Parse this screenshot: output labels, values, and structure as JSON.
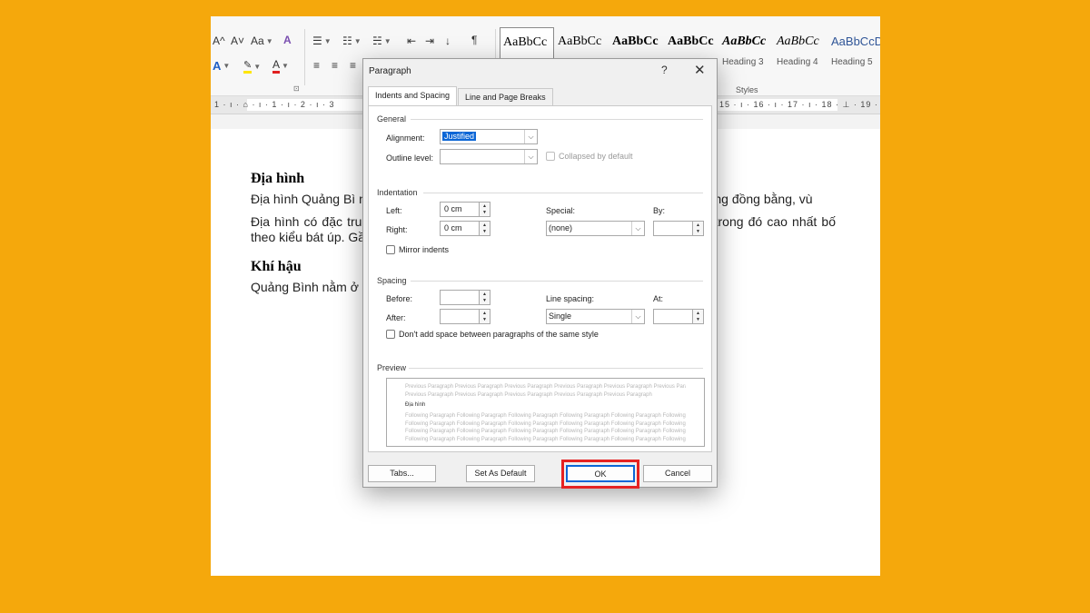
{
  "ribbon": {
    "grow_font": "A^",
    "shrink_font": "A˅",
    "change_case": "Aa",
    "clear_formatting": "A",
    "show_marks": "¶",
    "styles_label": "Styles",
    "paragraph_launcher": "⊡",
    "styles": [
      {
        "sample": "AaBbCc",
        "name": ""
      },
      {
        "sample": "AaBbCc",
        "name": ""
      },
      {
        "sample": "AaBbCc",
        "name": ""
      },
      {
        "sample": "AaBbCc",
        "name": ""
      },
      {
        "sample": "AaBbCc",
        "name": "Heading 3"
      },
      {
        "sample": "AaBbCc",
        "name": "Heading 4"
      },
      {
        "sample": "AaBbCcD",
        "name": "Heading 5"
      }
    ]
  },
  "ruler": {
    "left_text": "1 · ı · ⌂ · ı · 1 · ı · 2 · ı · 3",
    "right_text": "15 · ı · 16 · ı · 17 · ı · 18 · ⊥ · 19 ·"
  },
  "document": {
    "heading1": "Địa hình",
    "para1": "Địa hình Quảng Bì                                                                                                    n tích tự nhiên là đồi núi. Toàn bộ diện t                                                                                                    ùng đồi và trung du, vùng đồng bằng, vù",
    "para2": "Địa hình có đặc tru                                                                                                    núi chiếm 85% diện tích toàn tỉnh và bị                                                                                                    cao 1.000-1.500 m, trong đó cao nhất                                                                                                    bố theo kiểu bát úp. Gần bờ biển có dải                                                                                                    iển có dạng lưỡi liềm hoặc dẻ quạt.",
    "heading2": "Khí hậu",
    "para3": "Quảng Bình nằm ở                                                                                                    hia phía Bắc và phía Nam và được chia"
  },
  "dialog": {
    "title": "Paragraph",
    "help": "?",
    "close": "✕",
    "tabs": [
      "Indents and Spacing",
      "Line and Page Breaks"
    ],
    "general": {
      "section": "General",
      "alignment_label": "Alignment:",
      "alignment_value": "Justified",
      "outline_label": "Outline level:",
      "outline_value": "",
      "collapsed_label": "Collapsed by default"
    },
    "indentation": {
      "section": "Indentation",
      "left_label": "Left:",
      "left_value": "0 cm",
      "right_label": "Right:",
      "right_value": "0 cm",
      "special_label": "Special:",
      "special_value": "(none)",
      "by_label": "By:",
      "by_value": "",
      "mirror_label": "Mirror indents"
    },
    "spacing": {
      "section": "Spacing",
      "before_label": "Before:",
      "before_value": "",
      "after_label": "After:",
      "after_value": "",
      "line_spacing_label": "Line spacing:",
      "line_spacing_value": "Single",
      "at_label": "At:",
      "at_value": "",
      "dont_add_label": "Don't add space between paragraphs of the same style"
    },
    "preview": {
      "section": "Preview",
      "prev1": "Previous Paragraph Previous Paragraph Previous Paragraph Previous Paragraph Previous Paragraph Previous Paragraph",
      "prev2": "Previous Paragraph Previous Paragraph Previous Paragraph Previous Paragraph Previous Paragraph",
      "main": "Địa hình",
      "follow1": "Following Paragraph Following Paragraph Following Paragraph Following Paragraph Following Paragraph Following Paragraph",
      "follow2": "Following Paragraph Following Paragraph Following Paragraph Following Paragraph Following Paragraph Following Paragraph",
      "follow3": "Following Paragraph Following Paragraph Following Paragraph Following Paragraph Following Paragraph Following Paragraph",
      "follow4": "Following Paragraph Following Paragraph Following Paragraph Following Paragraph Following Paragraph Following Paragraph"
    },
    "buttons": {
      "tabs": "Tabs...",
      "set_default": "Set As Default",
      "ok": "OK",
      "cancel": "Cancel"
    }
  },
  "colors": {
    "background": "#f5a80c",
    "highlight": "#e52222",
    "selection": "#0b66d6"
  }
}
